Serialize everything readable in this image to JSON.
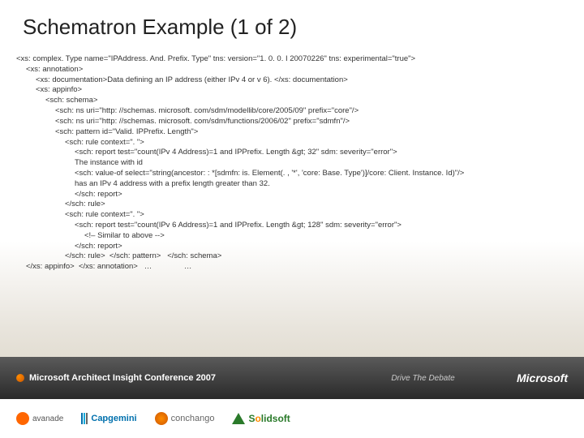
{
  "title": "Schematron Example (1 of 2)",
  "code": {
    "l1": "<xs: complex. Type name=\"IPAddress. And. Prefix. Type\" tns: version=\"1. 0. 0. I 20070226\" tns: experimental=\"true\">",
    "l2": "<xs: annotation>",
    "l3": "<xs: documentation>Data defining an IP address (either IPv 4 or v 6). </xs: documentation>",
    "l4": "<xs: appinfo>",
    "l5": "<sch: schema>",
    "l6": "<sch: ns uri=\"http: //schemas. microsoft. com/sdm/modellib/core/2005/09\" prefix=\"core\"/>",
    "l7": "<sch: ns uri=\"http: //schemas. microsoft. com/sdm/functions/2006/02\" prefix=\"sdmfn\"/>",
    "l8": "<sch: pattern id=\"Valid. IPPrefix. Length\">",
    "l9": "<sch: rule context=\". \">",
    "l10": "<sch: report test=\"count(IPv 4 Address)=1 and IPPrefix. Length &gt; 32\" sdm: severity=\"error\">",
    "l11": "The instance with id",
    "l12": "<sch: value-of select=\"string(ancestor: : *[sdmfn: is. Element(. , '*', 'core: Base. Type')]/core: Client. Instance. Id)\"/>",
    "l13": "has an IPv 4 address with a prefix length greater than 32.",
    "l14": "</sch: report>",
    "l15": "</sch: rule>",
    "l16": "<sch: rule context=\". \">",
    "l17": "<sch: report test=\"count(IPv 6 Address)=1 and IPPrefix. Length &gt; 128\" sdm: severity=\"error\">",
    "l18": "<!– Similar to above -->",
    "l19": "</sch: report>",
    "l20": "</sch: rule>  </sch: pattern>   </sch: schema>",
    "l21": "</xs: appinfo>  </xs: annotation>   …               …"
  },
  "footer": {
    "conference": "Microsoft Architect Insight Conference 2007",
    "tagline": "Drive The Debate",
    "brand": "Microsoft"
  },
  "sponsors": {
    "s1": "avanade",
    "s2": "Capgemini",
    "s3": "conchango",
    "s4a": "S",
    "s4b": "o",
    "s4c": "lidsoft"
  }
}
